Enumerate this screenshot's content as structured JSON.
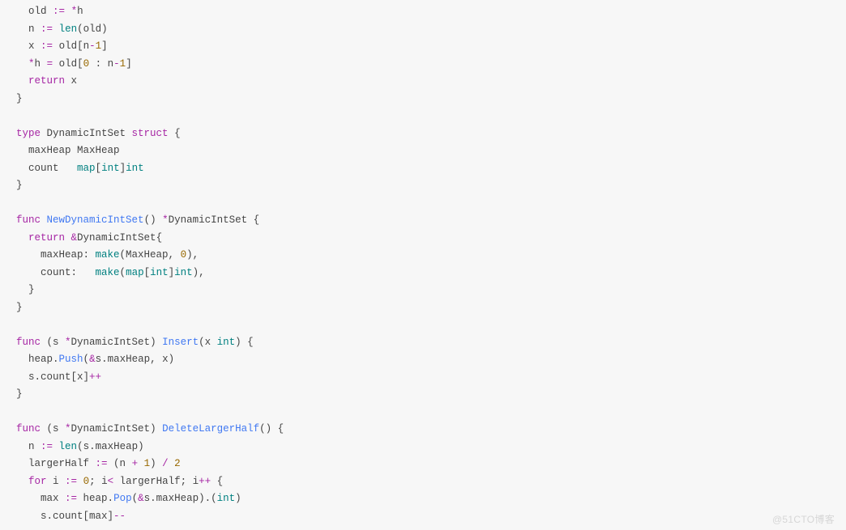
{
  "watermark": "@51CTO博客",
  "code": {
    "l1_a": "old",
    "l1_op": ":=",
    "l1_b": "*",
    "l1_c": "h",
    "l2_a": "n",
    "l2_op": ":=",
    "l2_fn": "len",
    "l2_c": "(old)",
    "l3_a": "x",
    "l3_op": ":=",
    "l3_b": "old[n",
    "l3_minus": "-",
    "l3_num": "1",
    "l3_c": "]",
    "l4_a": "*",
    "l4_b": "h",
    "l4_eq": "=",
    "l4_c": "old[",
    "l4_num0": "0",
    "l4_colon": " : ",
    "l4_d": "n",
    "l4_minus": "-",
    "l4_num1": "1",
    "l4_e": "]",
    "l5_ret": "return",
    "l5_x": " x",
    "l6": "}",
    "l8_type": "type",
    "l8_name": " DynamicIntSet ",
    "l8_struct": "struct",
    "l8_brace": " {",
    "l9": "maxHeap MaxHeap",
    "l10_a": "count   ",
    "l10_map": "map",
    "l10_b": "[",
    "l10_int1": "int",
    "l10_c": "]",
    "l10_int2": "int",
    "l11": "}",
    "l13_func": "func",
    "l13_name": "NewDynamicIntSet",
    "l13_sig": "() ",
    "l13_star": "*",
    "l13_ret": "DynamicIntSet {",
    "l14_ret": "return",
    "l14_amp": " &",
    "l14_a": "DynamicIntSet{",
    "l15_a": "maxHeap: ",
    "l15_make": "make",
    "l15_b": "(MaxHeap, ",
    "l15_num": "0",
    "l15_c": "),",
    "l16_a": "count:   ",
    "l16_make": "make",
    "l16_b": "(",
    "l16_map": "map",
    "l16_c": "[",
    "l16_int1": "int",
    "l16_d": "]",
    "l16_int2": "int",
    "l16_e": "),",
    "l17": "}",
    "l18": "}",
    "l20_func": "func",
    "l20_a": " (s ",
    "l20_star": "*",
    "l20_b": "DynamicIntSet) ",
    "l20_name": "Insert",
    "l20_c": "(x ",
    "l20_int": "int",
    "l20_d": ") {",
    "l21_a": "heap.",
    "l21_push": "Push",
    "l21_b": "(",
    "l21_amp": "&",
    "l21_c": "s.maxHeap, x)",
    "l22_a": "s.count[x]",
    "l22_pp": "++",
    "l23": "}",
    "l25_func": "func",
    "l25_a": " (s ",
    "l25_star": "*",
    "l25_b": "DynamicIntSet) ",
    "l25_name": "DeleteLargerHalf",
    "l25_c": "() {",
    "l26_a": "n",
    "l26_op": " := ",
    "l26_len": "len",
    "l26_b": "(s.maxHeap)",
    "l27_a": "largerHalf",
    "l27_op": " := ",
    "l27_b": "(n ",
    "l27_plus": "+",
    "l27_c": " ",
    "l27_num1": "1",
    "l27_d": ") ",
    "l27_div": "/",
    "l27_e": " ",
    "l27_num2": "2",
    "l28_for": "for",
    "l28_a": " i",
    "l28_op": " := ",
    "l28_num": "0",
    "l28_b": "; i",
    "l28_lt": "<",
    "l28_c": " largerHalf; i",
    "l28_pp": "++",
    "l28_d": " {",
    "l29_a": "max",
    "l29_op": " := ",
    "l29_b": "heap.",
    "l29_pop": "Pop",
    "l29_c": "(",
    "l29_amp": "&",
    "l29_d": "s.maxHeap).(",
    "l29_int": "int",
    "l29_e": ")",
    "l30_a": "s.count[max]",
    "l30_mm": "--"
  }
}
